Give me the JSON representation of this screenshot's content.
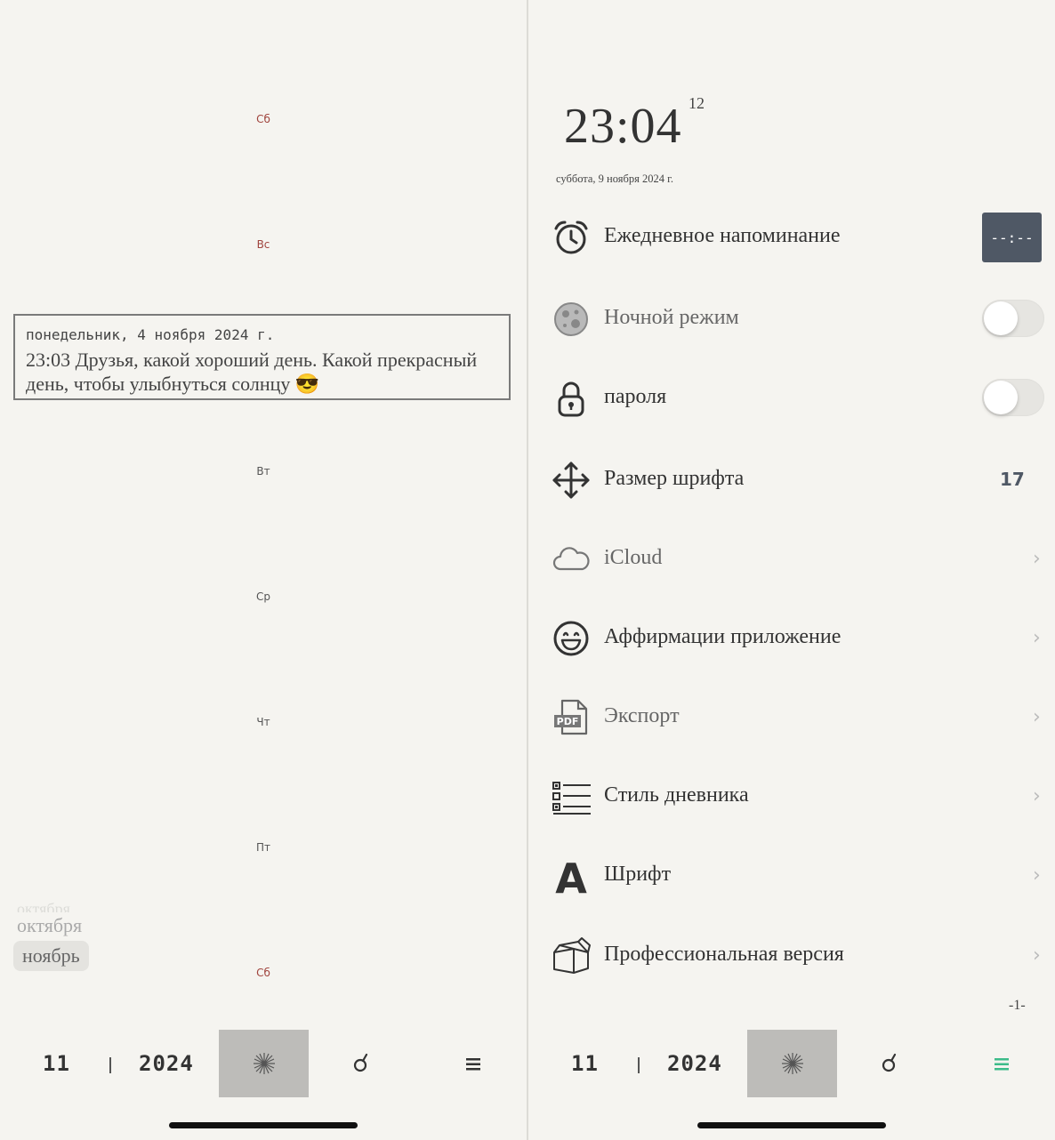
{
  "left": {
    "day_labels": [
      "Сб",
      "Вс",
      "Вт",
      "Ср",
      "Чт",
      "Пт",
      "Сб"
    ],
    "entry": {
      "date": "понедельник, 4 ноября 2024 г.",
      "text": "23:03 Друзья, какой хороший день. Какой прекрасный день, чтобы улыбнуться солнцу 😎"
    },
    "months": [
      "октября",
      "октября",
      "ноябрь"
    ]
  },
  "tabbar": {
    "month": "11",
    "year": "2024"
  },
  "right": {
    "clock": {
      "time": "23:04",
      "seconds": "12"
    },
    "date": "суббота, 9 ноября 2024 г.",
    "settings": {
      "reminder": {
        "label": "Ежедневное напоминание",
        "time_value": "--:--"
      },
      "night_mode": {
        "label": "Ночной режим"
      },
      "password": {
        "label": "пароля"
      },
      "font_size": {
        "label": "Размер шрифта",
        "value": "17"
      },
      "icloud": {
        "label": "iCloud"
      },
      "affirmations": {
        "label": "Аффирмации приложение"
      },
      "export": {
        "label": "Экспорт",
        "icon_text": "PDF"
      },
      "diary_style": {
        "label": "Стиль дневника"
      },
      "font": {
        "label": "Шрифт",
        "icon_text": "A"
      },
      "pro": {
        "label": "Профессиональная версия"
      }
    },
    "page_indicator": "-1-"
  },
  "colors": {
    "background": "#f5f4f0",
    "weekend": "#a0443d",
    "accent_dark": "#4f5865",
    "menu_active": "#3dbb8a",
    "tab_center_bg": "#bdbcb9"
  }
}
